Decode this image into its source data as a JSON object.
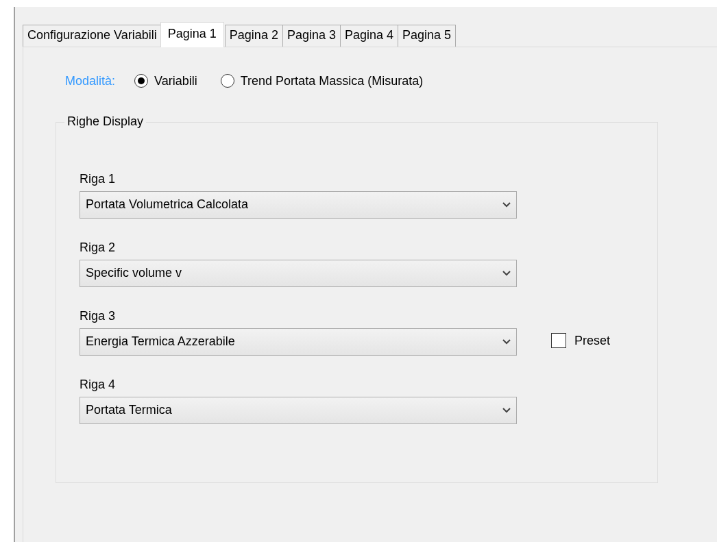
{
  "tabs": [
    {
      "label": "Configurazione Variabili",
      "selected": false
    },
    {
      "label": "Pagina 1",
      "selected": true
    },
    {
      "label": "Pagina 2",
      "selected": false
    },
    {
      "label": "Pagina 3",
      "selected": false
    },
    {
      "label": "Pagina 4",
      "selected": false
    },
    {
      "label": "Pagina 5",
      "selected": false
    }
  ],
  "mode": {
    "label": "Modalità:",
    "options": [
      {
        "label": "Variabili",
        "selected": true
      },
      {
        "label": "Trend Portata Massica (Misurata)",
        "selected": false
      }
    ]
  },
  "group": {
    "title": "Righe Display",
    "rows": [
      {
        "label": "Riga 1",
        "value": "Portata Volumetrica Calcolata"
      },
      {
        "label": "Riga 2",
        "value": "Specific volume v"
      },
      {
        "label": "Riga 3",
        "value": "Energia Termica Azzerabile",
        "checkbox": {
          "label": "Preset",
          "checked": false
        }
      },
      {
        "label": "Riga 4",
        "value": "Portata Termica"
      }
    ]
  }
}
